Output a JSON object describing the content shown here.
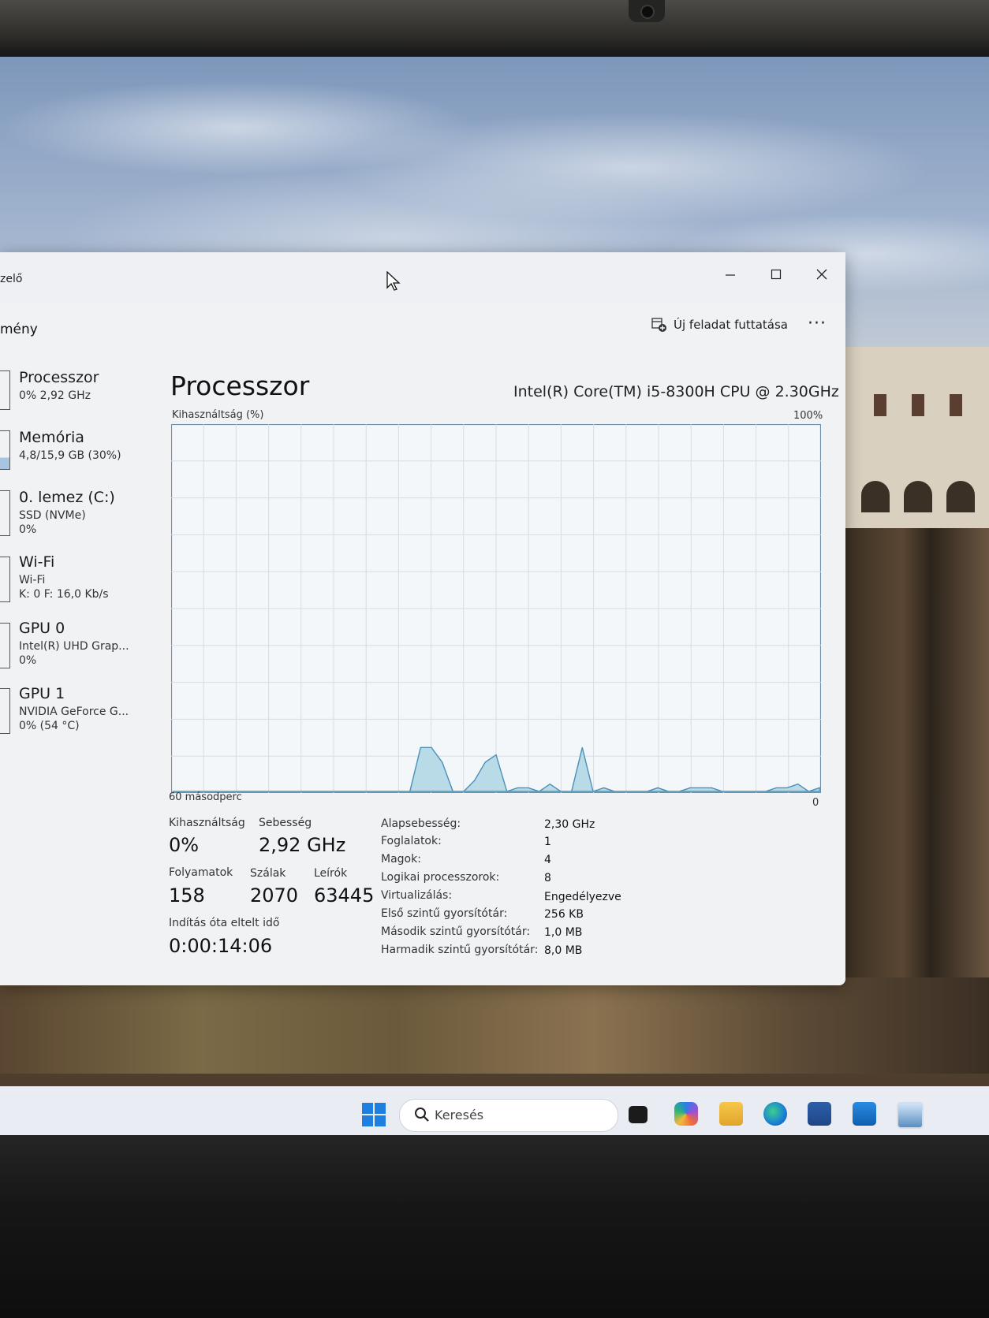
{
  "window": {
    "title_fragment": "zelő",
    "controls": {
      "minimize": "—",
      "maximize": "☐",
      "close": "✕"
    }
  },
  "toolbar": {
    "page_heading_fragment": "mény",
    "run_task_label": "Új feladat futtatása",
    "more_label": "···"
  },
  "sidebar": {
    "items": [
      {
        "title": "Processzor",
        "sub1": "0% 2,92 GHz",
        "sub2": ""
      },
      {
        "title": "Memória",
        "sub1": "4,8/15,9 GB (30%)",
        "sub2": ""
      },
      {
        "title": "0. lemez (C:)",
        "sub1": "SSD (NVMe)",
        "sub2": "0%"
      },
      {
        "title": "Wi-Fi",
        "sub1": "Wi-Fi",
        "sub2": "K: 0 F: 16,0 Kb/s"
      },
      {
        "title": "GPU 0",
        "sub1": "Intel(R) UHD Grap...",
        "sub2": "0%"
      },
      {
        "title": "GPU 1",
        "sub1": "NVIDIA GeForce G...",
        "sub2": "0% (54 °C)"
      }
    ]
  },
  "main": {
    "title": "Processzor",
    "cpu_name": "Intel(R) Core(TM) i5-8300H CPU @ 2.30GHz",
    "graph_ylabel": "Kihasználtság (%)",
    "graph_ymax_label": "100%",
    "graph_xlabel": "60 másodperc",
    "graph_ymin_label": "0"
  },
  "chart_data": {
    "type": "area",
    "title": "",
    "xlabel": "60 másodperc",
    "ylabel": "Kihasználtság (%)",
    "ylim": [
      0,
      100
    ],
    "xlim": [
      0,
      60
    ],
    "grid": true,
    "color": "#4a90b8",
    "fill": "#b9dbe8",
    "x": [
      0,
      1,
      2,
      3,
      4,
      5,
      6,
      7,
      8,
      9,
      10,
      11,
      12,
      13,
      14,
      15,
      16,
      17,
      18,
      19,
      20,
      21,
      22,
      23,
      24,
      25,
      26,
      27,
      28,
      29,
      30,
      31,
      32,
      33,
      34,
      35,
      36,
      37,
      38,
      39,
      40,
      41,
      42,
      43,
      44,
      45,
      46,
      47,
      48,
      49,
      50,
      51,
      52,
      53,
      54,
      55,
      56,
      57,
      58,
      59,
      60
    ],
    "values": [
      0,
      0,
      0,
      0,
      0,
      0,
      0,
      0,
      0,
      0,
      0,
      0,
      0,
      0,
      0,
      0,
      0,
      0,
      0,
      0,
      0,
      0,
      0,
      12,
      12,
      8,
      0,
      0,
      3,
      8,
      10,
      0,
      1,
      1,
      0,
      2,
      0,
      0,
      12,
      0,
      1,
      0,
      0,
      0,
      0,
      1,
      0,
      0,
      1,
      1,
      1,
      0,
      0,
      0,
      0,
      0,
      1,
      1,
      2,
      0,
      1
    ]
  },
  "stats": {
    "utilization_label": "Kihasználtság",
    "utilization_value": "0%",
    "speed_label": "Sebesség",
    "speed_value": "2,92 GHz",
    "processes_label": "Folyamatok",
    "processes_value": "158",
    "threads_label": "Szálak",
    "threads_value": "2070",
    "handles_label": "Leírók",
    "handles_value": "63445",
    "uptime_label": "Indítás óta eltelt idő",
    "uptime_value": "0:00:14:06"
  },
  "info": [
    {
      "label": "Alapsebesség:",
      "value": "2,30 GHz"
    },
    {
      "label": "Foglalatok:",
      "value": "1"
    },
    {
      "label": "Magok:",
      "value": "4"
    },
    {
      "label": "Logikai processzorok:",
      "value": "8"
    },
    {
      "label": "Virtualizálás:",
      "value": "Engedélyezve"
    },
    {
      "label": "Első szintű gyorsítótár:",
      "value": "256 KB"
    },
    {
      "label": "Második szintű gyorsítótár:",
      "value": "1,0 MB"
    },
    {
      "label": "Harmadik szintű gyorsítótár:",
      "value": "8,0 MB"
    }
  ],
  "taskbar": {
    "search_placeholder": "Keresés",
    "icons": [
      "task-view-icon",
      "copilot-icon",
      "file-explorer-icon",
      "edge-icon",
      "store-icon",
      "outlook-icon",
      "task-manager-icon"
    ]
  }
}
